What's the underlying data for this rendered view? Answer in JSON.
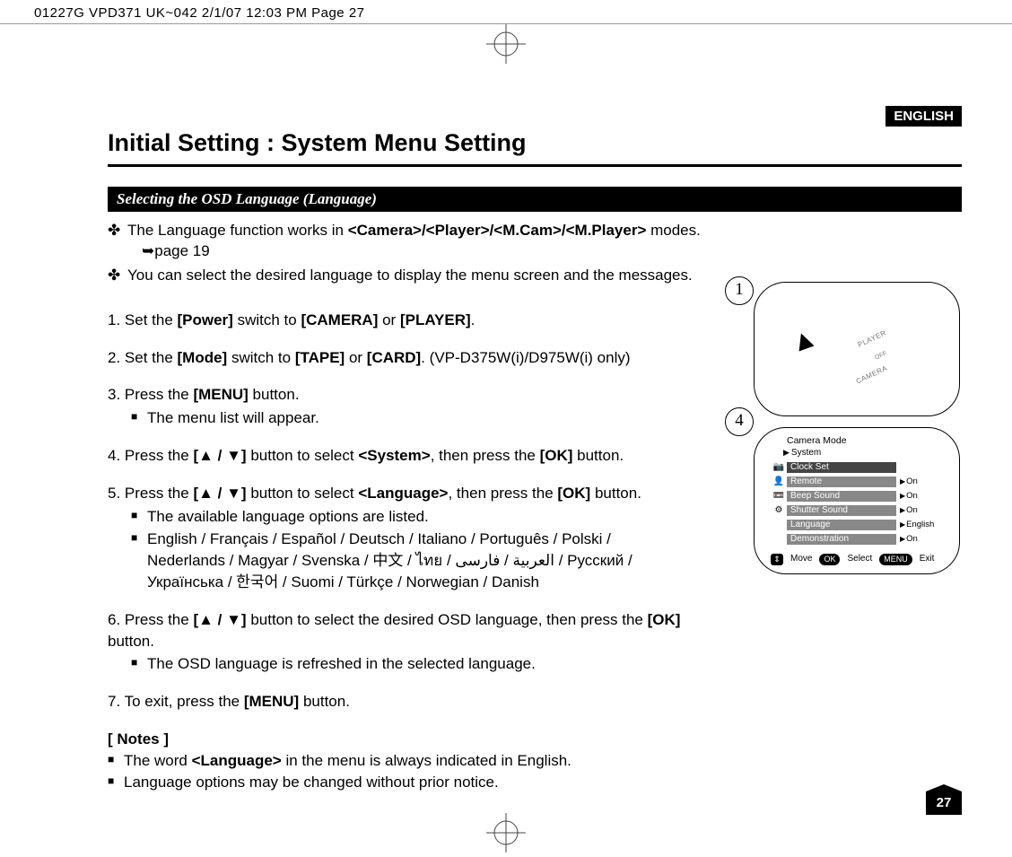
{
  "header_line": "01227G VPD371 UK~042  2/1/07 12:03 PM  Page 27",
  "lang_badge": "ENGLISH",
  "title": "Initial Setting : System Menu Setting",
  "subhead": "Selecting the OSD Language (Language)",
  "intro": {
    "bullet_mark": "✤",
    "line1_pre": "The Language function works in ",
    "line1_bold": "<Camera>/<Player>/<M.Cam>/<M.Player>",
    "line1_post": " modes.",
    "line1_ref": "➥page 19",
    "line2": "You can select the desired language to display the menu screen and the messages."
  },
  "steps": {
    "s1": {
      "pre": "1. Set the ",
      "b1": "[Power]",
      "mid": " switch to ",
      "b2": "[CAMERA]",
      "mid2": " or ",
      "b3": "[PLAYER]",
      "post": "."
    },
    "s2": {
      "pre": "2. Set the ",
      "b1": "[Mode]",
      "mid": " switch to ",
      "b2": "[TAPE]",
      "mid2": " or ",
      "b3": "[CARD]",
      "post": ". (VP-D375W(i)/D975W(i) only)"
    },
    "s3": {
      "pre": "3. Press the ",
      "b1": "[MENU]",
      "post": " button.",
      "sub1": "The menu list will appear."
    },
    "s4": {
      "pre": "4. Press the ",
      "b1": "[▲ / ▼]",
      "mid": " button to select ",
      "b2": "<System>",
      "mid2": ", then press the ",
      "b3": "[OK]",
      "post": " button."
    },
    "s5": {
      "pre": "5. Press the ",
      "b1": "[▲ / ▼]",
      "mid": " button to select ",
      "b2": "<Language>",
      "mid2": ", then press the ",
      "b3": "[OK]",
      "post": " button.",
      "sub1": "The available language options are listed.",
      "sub2": "English / Français / Español / Deutsch / Italiano / Português / Polski / Nederlands / Magyar / Svenska / 中文 / ไทย / العربية / فارسی / Русский / Українська / 한국어 / Suomi / Türkçe / Norwegian / Danish"
    },
    "s6": {
      "pre": "6. Press the ",
      "b1": "[▲ / ▼]",
      "mid": " button to select the desired OSD language, then press the ",
      "b2": "[OK]",
      "post": " button.",
      "sub1": "The OSD language is refreshed in the selected language."
    },
    "s7": {
      "pre": "7. To exit, press the ",
      "b1": "[MENU]",
      "post": " button."
    }
  },
  "notes": {
    "title": "[ Notes ]",
    "n1_pre": "The word ",
    "n1_b": "<Language>",
    "n1_post": " in the menu is always indicated in English.",
    "n2": "Language options may be changed without prior notice."
  },
  "fig": {
    "num1": "1",
    "num4": "4",
    "player": "PLAYER",
    "off": "OFF",
    "camera": "CAMERA",
    "osd_title": "Camera Mode",
    "osd_sub": "System",
    "rows": [
      {
        "icon": "📷",
        "label": "Clock Set",
        "val": ""
      },
      {
        "icon": "👤",
        "label": "Remote",
        "val": "On"
      },
      {
        "icon": "📼",
        "label": "Beep Sound",
        "val": "On"
      },
      {
        "icon": "⚙",
        "label": "Shutter Sound",
        "val": "On"
      },
      {
        "icon": "",
        "label": "Language",
        "val": "English"
      },
      {
        "icon": "",
        "label": "Demonstration",
        "val": "On"
      }
    ],
    "foot": {
      "move": "Move",
      "ok": "OK",
      "select": "Select",
      "menu": "MENU",
      "exit": "Exit"
    }
  },
  "page_number": "27"
}
